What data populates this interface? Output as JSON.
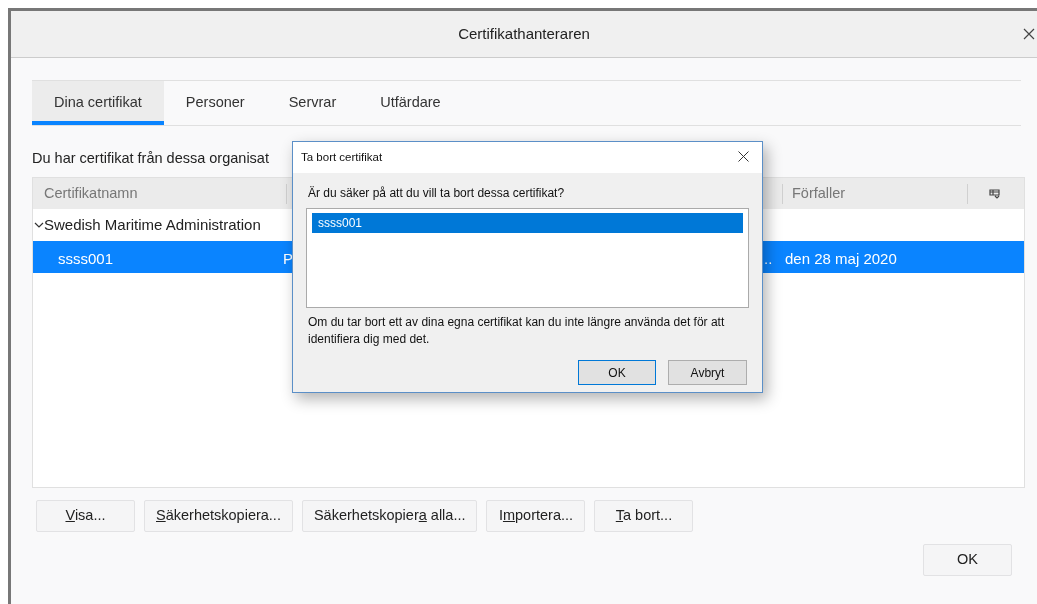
{
  "window": {
    "title": "Certifikathanteraren"
  },
  "tabs": [
    {
      "label": "Dina certifikat",
      "selected": true
    },
    {
      "label": "Personer",
      "selected": false
    },
    {
      "label": "Servrar",
      "selected": false
    },
    {
      "label": "Utfärdare",
      "selected": false
    }
  ],
  "intro": "Du har certifikat från dessa organisat",
  "table": {
    "columns": [
      "Certifikatnamn",
      "Förfaller"
    ],
    "rows": [
      {
        "kind": "group",
        "name": "Swedish Maritime Administration",
        "expanded": true,
        "selected": false
      },
      {
        "kind": "cert",
        "name": "ssss001",
        "column_2": "P",
        "column_3": "..",
        "expires": "den 28 maj 2020",
        "selected": true
      }
    ]
  },
  "buttons": [
    {
      "key": "V",
      "after": "isa..."
    },
    {
      "key": "S",
      "after": "äkerhetskopiera..."
    },
    {
      "before": "Säkerhetskopier",
      "key": "a",
      "after": " alla..."
    },
    {
      "before": "I",
      "key": "m",
      "after": "portera..."
    },
    {
      "key": "T",
      "after": "a bort..."
    }
  ],
  "ok": "OK",
  "dialog": {
    "title": "Ta bort certifikat",
    "question": "Är du säker på att du vill ta bort dessa certifikat?",
    "items": [
      {
        "label": "ssss001",
        "selected": true
      }
    ],
    "note": "Om du tar bort ett av dina egna certifikat kan du inte längre använda det för att identifiera dig med det.",
    "ok": "OK",
    "cancel": "Avbryt"
  }
}
